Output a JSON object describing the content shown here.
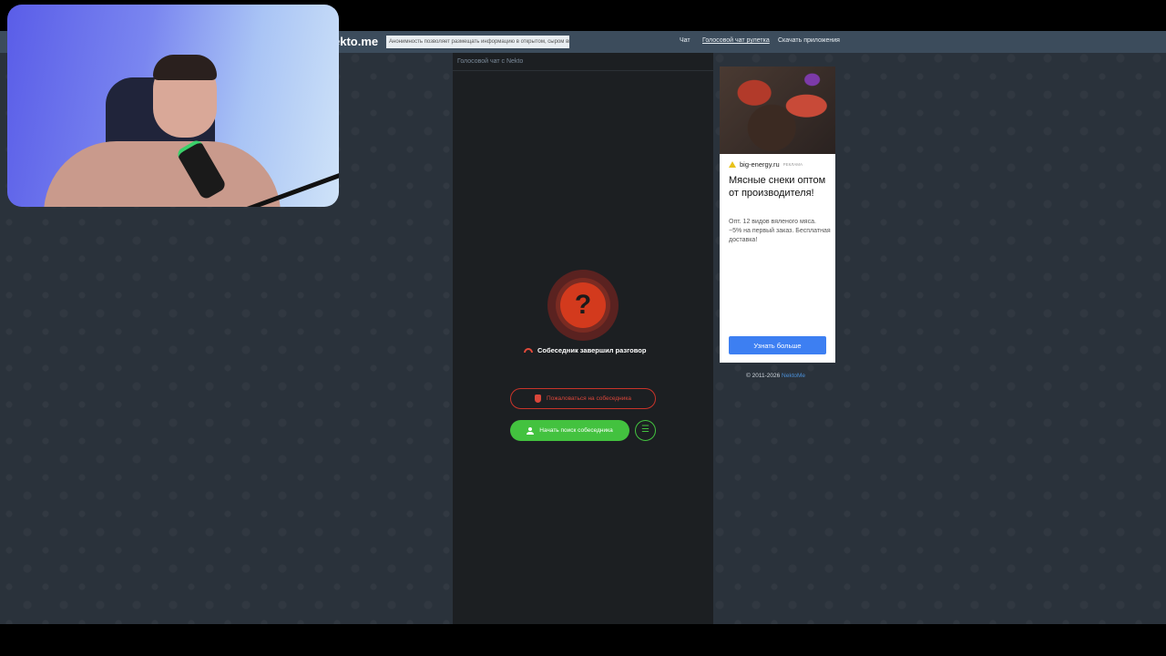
{
  "header": {
    "logo": "ekto.me",
    "notice": "Анонимность позволяет размещать информацию в открытом, сыром виде!",
    "nav": [
      "Чат",
      "Голосовой чат рулетка",
      "Скачать приложения"
    ]
  },
  "chat": {
    "title": "Голосовой чат с Nekto",
    "status_icon": "question-mark",
    "status_text": "Собеседник завершил разговор",
    "report_label": "Пожаловаться на собеседника",
    "search_label": "Начать поиск собеседника",
    "filter_icon": "sliders-icon"
  },
  "ad": {
    "source": "big-energy.ru",
    "tag": "РЕКЛАМА",
    "headline": "Мясные снеки оптом от производителя!",
    "body": "Опт. 12 видов вяленого мяса. −5% на первый заказ. Бесплатная доставка!",
    "button": "Узнать больше"
  },
  "footer": {
    "copyright": "© 2011-2026",
    "link": "NektoMe"
  },
  "colors": {
    "accent_green": "#43c23f",
    "accent_red": "#d33a1d",
    "ad_button": "#3d7ff2"
  }
}
